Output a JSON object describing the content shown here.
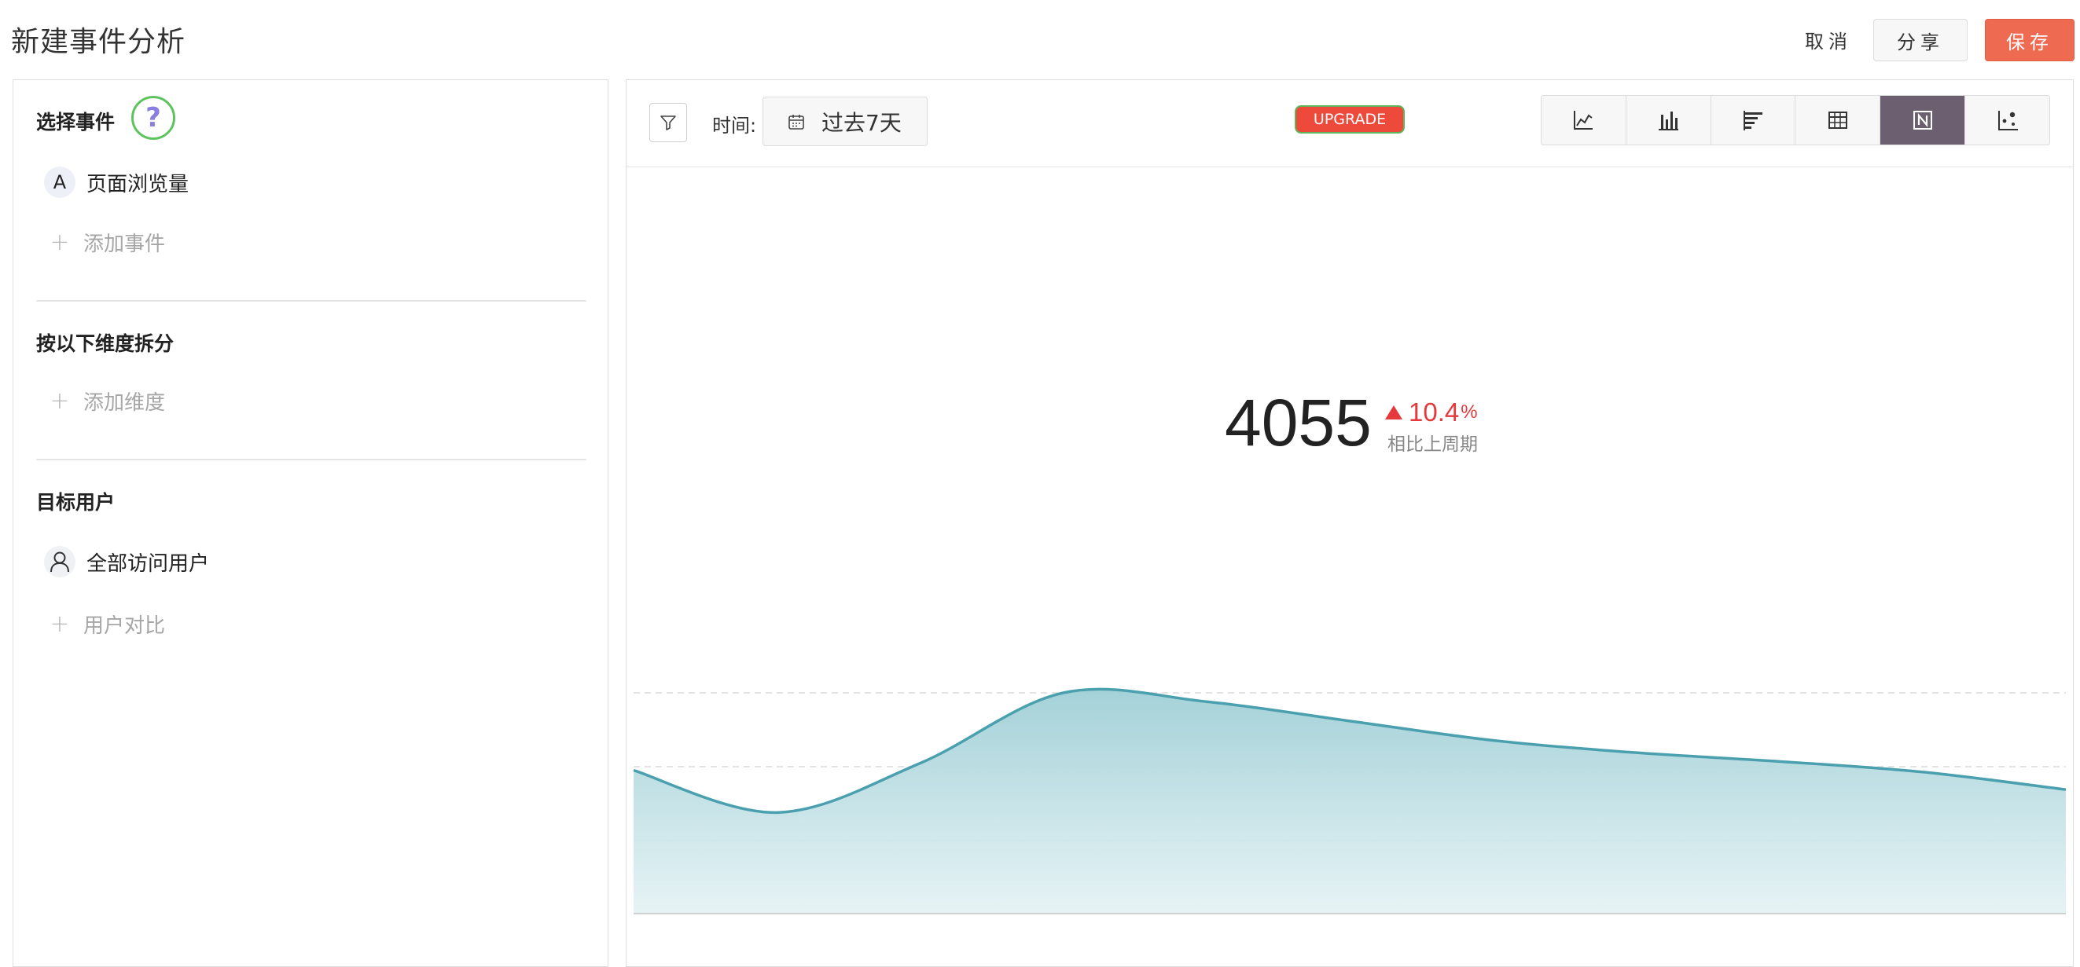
{
  "header": {
    "title": "新建事件分析",
    "cancel_label": "取消",
    "share_label": "分享",
    "save_label": "保存"
  },
  "sidebar": {
    "events_title": "选择事件",
    "help_glyph": "?",
    "events": [
      {
        "badge": "A",
        "label": "页面浏览量"
      }
    ],
    "add_event_label": "添加事件",
    "dimension_title": "按以下维度拆分",
    "add_dimension_label": "添加维度",
    "target_title": "目标用户",
    "target_user_label": "全部访问用户",
    "compare_label": "用户对比"
  },
  "toolbar": {
    "time_label": "时间:",
    "time_value": "过去7天",
    "upgrade_label": "UPGRADE",
    "chart_types": [
      "line-chart-icon",
      "bar-chart-icon",
      "horizontal-bar-icon",
      "table-icon",
      "number-icon",
      "scatter-icon"
    ],
    "active_chart_type": "number-icon"
  },
  "metric": {
    "value": "4055",
    "change": "10.4",
    "change_unit": "%",
    "change_label": "相比上周期",
    "direction": "up"
  },
  "colors": {
    "accent": "#ee6a50",
    "upgrade": "#ee4a3c",
    "up": "#e5393b",
    "area_stroke": "#4aa0ae",
    "active_tab": "#6c5f70"
  },
  "chart_data": {
    "type": "area",
    "values": [
      0.56,
      0.32,
      0.6,
      1.0,
      0.95,
      0.84,
      0.73,
      0.66,
      0.61,
      0.55,
      0.45
    ],
    "grid": true
  }
}
